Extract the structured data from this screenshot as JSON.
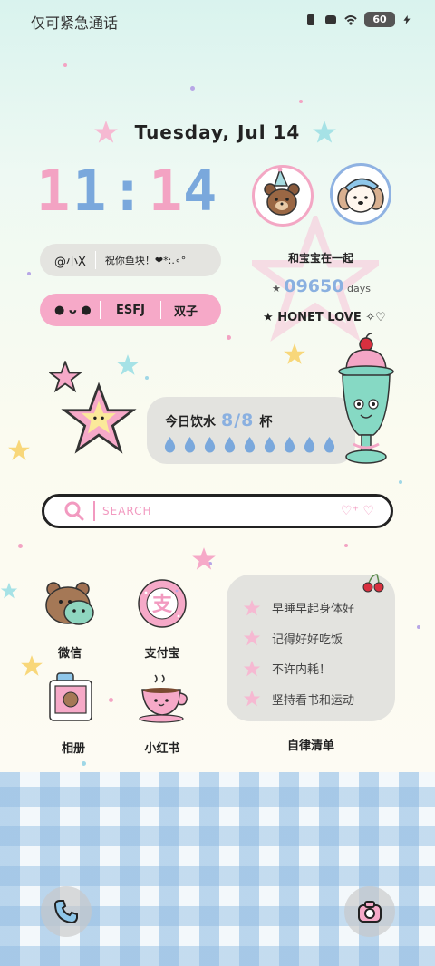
{
  "status_bar": {
    "carrier_text": "仅可紧急通话",
    "battery": "60",
    "icons": [
      "vibrate-icon",
      "message-icon",
      "wifi-icon",
      "battery-icon",
      "charging-icon"
    ]
  },
  "date": "Tuesday, Jul 14",
  "clock": {
    "h1": "1",
    "h2": "1",
    "colon": ":",
    "m1": "1",
    "m2": "4"
  },
  "profile": {
    "name": "@小X",
    "motto": "祝你鱼块！❤*:.∘°",
    "face": "●  ᴗ  ●",
    "mbti": "ESFJ",
    "zodiac": "双子"
  },
  "together": {
    "title": "和宝宝在一起",
    "days_value": "09650",
    "days_unit": "days",
    "love_text": "HONET LOVE"
  },
  "water": {
    "label": "今日饮水",
    "count": "8/8",
    "unit": "杯",
    "drops_filled": 9
  },
  "search": {
    "placeholder": "SEARCH"
  },
  "apps": [
    {
      "label": "微信"
    },
    {
      "label": "支付宝"
    },
    {
      "label": "相册"
    },
    {
      "label": "小红书"
    }
  ],
  "todo": {
    "items": [
      "早睡早起身体好",
      "记得好好吃饭",
      "不许内耗！",
      "坚持看书和运动"
    ],
    "title": "自律清单"
  },
  "dock": {
    "left": "phone-icon",
    "right": "camera-icon"
  },
  "colors": {
    "pink": "#f3a3c3",
    "blue": "#7aa8dc",
    "widget_grey": "#e3e3df"
  }
}
